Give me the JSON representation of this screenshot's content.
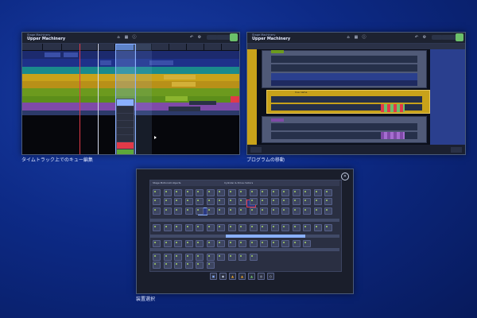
{
  "screen1": {
    "caption": "タイムトラック上でのキュー編集",
    "header_sub": "Stage Machinery",
    "header_title": "Upper Machinery"
  },
  "screen2": {
    "caption": "プログラムの移動",
    "header_sub": "Stage Machinery",
    "header_title": "Upper Machinery",
    "program_label": "Cue name"
  },
  "screen3": {
    "caption": "装置選択",
    "title": "Cylinder & Drive motors",
    "tabs": [
      "Stage Motion",
      "All objects"
    ]
  },
  "colors": {
    "yellow": "#c8a21a",
    "green": "#6c9a1e",
    "purple": "#7f4aa8",
    "blue": "#2a3f8e",
    "red": "#e23a48",
    "teal": "#1a8a8c"
  }
}
